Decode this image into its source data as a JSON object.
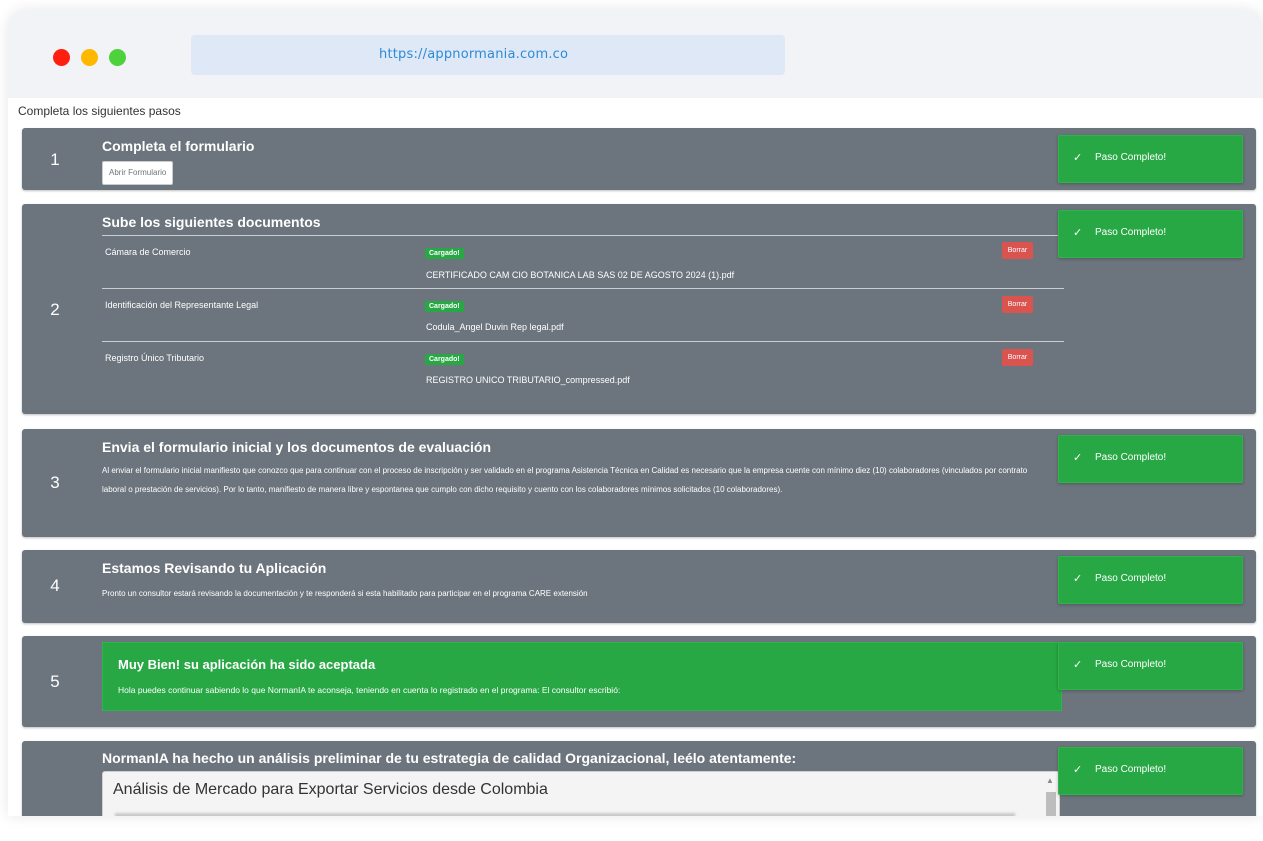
{
  "window": {
    "url": "https://appnormania.com.co",
    "traffic_lights": {
      "close": "#ff1f0f",
      "minimize": "#ffb800",
      "maximize": "#4dd23c"
    }
  },
  "page": {
    "heading": "Completa los siguientes pasos",
    "complete_label": "Paso Completo!",
    "check_icon": "✓",
    "colors": {
      "step_bg": "#6c757d",
      "success": "#28a745",
      "danger": "#d9534f"
    }
  },
  "steps": {
    "s1": {
      "number": "1",
      "title": "Completa el formulario",
      "button": "Abrir Formulario"
    },
    "s2": {
      "number": "2",
      "title": "Sube los siguientes documentos",
      "loaded_label": "Cargado!",
      "delete_label": "Borrar",
      "docs": [
        {
          "name": "Cámara de Comercio",
          "file": "CERTIFICADO CAM CIO BOTANICA LAB SAS 02 DE AGOSTO 2024 (1).pdf"
        },
        {
          "name": "Identificación del Representante Legal",
          "file": "Codula_Angel Duvin Rep legal.pdf"
        },
        {
          "name": "Registro Único Tributario",
          "file": "REGISTRO UNICO TRIBUTARIO_compressed.pdf"
        }
      ]
    },
    "s3": {
      "number": "3",
      "title": "Envia el formulario inicial y los documentos de evaluación",
      "text": "Al enviar el formulario inicial manifiesto que conozco que para continuar con el proceso de inscripción y ser validado en el programa Asistencia Técnica en Calidad es necesario que la empresa cuente con mínimo diez (10) colaboradores (vinculados por contrato laboral o prestación de servicios). Por lo tanto, manifiesto de manera libre y espontanea que cumplo con dicho requisito y cuento con los colaboradores mínimos solicitados (10 colaboradores)."
    },
    "s4": {
      "number": "4",
      "title": "Estamos Revisando tu Aplicación",
      "text": "Pronto un consultor estará revisando la documentación y te responderá si esta habilitado para participar en el programa CARE extensión"
    },
    "s5": {
      "number": "5",
      "title": "Muy Bien! su aplicación ha sido aceptada",
      "text": "Hola puedes continuar sabiendo lo que NormanIA te aconseja, teniendo en cuenta lo registrado en el programa: El consultor escribió:"
    },
    "s6": {
      "title": "NormanIA ha hecho un análisis preliminar de tu estrategia de calidad Organizacional, leélo atentamente:",
      "analysis_title": "Análisis de Mercado para Exportar Servicios desde Colombia"
    }
  }
}
